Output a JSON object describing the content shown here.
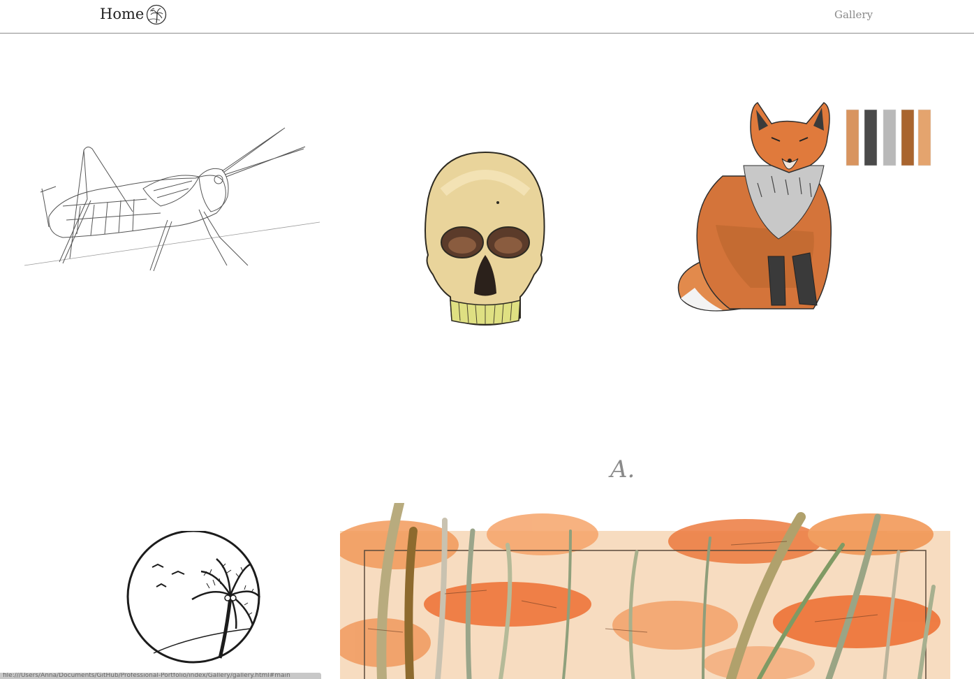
{
  "nav": {
    "home_label": "Home",
    "gallery_label": "Gallery",
    "logo_icon": "palm-moon-logo-icon"
  },
  "gallery": {
    "items": [
      {
        "name": "grasshopper-sketch",
        "icon": "grasshopper-artwork"
      },
      {
        "name": "skull-painting",
        "icon": "skull-artwork"
      },
      {
        "name": "fox-painting",
        "icon": "fox-artwork"
      },
      {
        "name": "palm-tree-logo",
        "icon": "palm-circle-artwork"
      },
      {
        "name": "poppy-field-painting",
        "icon": "poppy-field-artwork"
      }
    ],
    "signature": "A.",
    "fox_palette": [
      "#d8945f",
      "#4a4a4a",
      "#b9b9b9",
      "#a9652f",
      "#e4a46e"
    ]
  },
  "status_bar": {
    "url": "file:///Users/Anna/Documents/GitHub/Professional-Portfolio/index/Gallery/gallery.html#main"
  }
}
